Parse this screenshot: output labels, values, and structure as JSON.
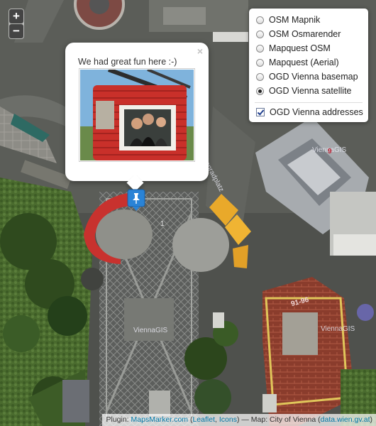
{
  "zoom": {
    "in_label": "+",
    "out_label": "−"
  },
  "layers": {
    "base": [
      {
        "label": "OSM Mapnik",
        "selected": false
      },
      {
        "label": "OSM Osmarender",
        "selected": false
      },
      {
        "label": "Mapquest OSM",
        "selected": false
      },
      {
        "label": "Mapquest (Aerial)",
        "selected": false
      },
      {
        "label": "OGD Vienna basemap",
        "selected": false
      },
      {
        "label": "OGD Vienna satellite",
        "selected": true
      }
    ],
    "overlays": [
      {
        "label": "OGD Vienna addresses",
        "checked": true
      }
    ]
  },
  "popup": {
    "text": "We had great fun here :-)",
    "close_label": "×"
  },
  "map_labels": {
    "watermark_1": "ViennaGIS",
    "watermark_2": "ViennaGIS",
    "watermark_3": "ViennaGIS",
    "street": "Riesenradplatz",
    "house_1": "1",
    "house_2": "9",
    "house_3": "91-96"
  },
  "attribution": {
    "prefix": "Plugin: ",
    "mapsmarker": "MapsMarker.com",
    "paren_open": " (",
    "leaflet": "Leaflet",
    "comma": ", ",
    "icons": "Icons",
    "mid": ") — Map: City of Vienna (",
    "data_link": "data.wien.gv.at",
    "suffix": ")"
  },
  "colors": {
    "ring_red": "#c8322e",
    "tent_yellow": "#e9a92a",
    "marker_blue": "#2a83d6",
    "link_blue": "#0078a8"
  }
}
